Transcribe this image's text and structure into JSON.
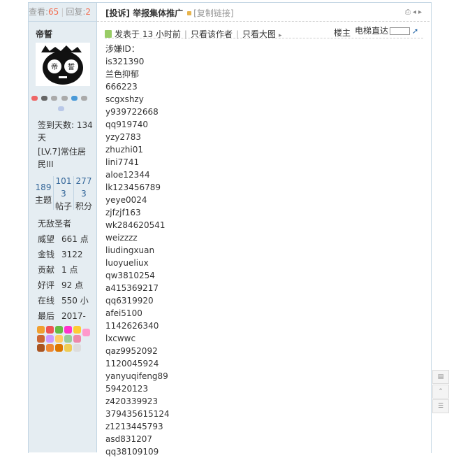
{
  "stats": {
    "views_label": "查看:",
    "views": "65",
    "replies_label": "回复:",
    "replies": "2"
  },
  "thread": {
    "title": "[投诉] 举报集体推广",
    "copy_link": "[复制链接]"
  },
  "author": {
    "username": "帝誓",
    "sign_days": "签到天数: 134 天",
    "level": "[LV.7]常住居民III",
    "counts": [
      {
        "value": "189",
        "label": "主题"
      },
      {
        "value": "1013",
        "label": "帖子"
      },
      {
        "value": "2773",
        "label": "积分"
      }
    ],
    "rank": "无敌圣者",
    "fields": [
      {
        "key": "威望",
        "value": "661 点"
      },
      {
        "key": "金钱",
        "value": "3122"
      },
      {
        "key": "贡献",
        "value": "1 点"
      },
      {
        "key": "好评",
        "value": "92 点"
      },
      {
        "key": "在线",
        "value": "550 小"
      },
      {
        "key": "最后",
        "value": "2017-"
      }
    ]
  },
  "post_meta": {
    "posted": "发表于 13 小时前",
    "only_author": "只看该作者",
    "big_image": "只看大图",
    "floor": "楼主",
    "elevator": "电梯直达"
  },
  "content_lines": [
    "涉嫌ID：",
    "is321390",
    "兰色抑郁",
    "666223",
    "scgxshzy",
    "y939722668",
    "qq919740",
    "yzy2783",
    "zhuzhi01",
    "lini7741",
    "aloe12344",
    "lk123456789",
    "yeye0024",
    "zjfzjf163",
    "wk284620541",
    "weizzzz",
    "liudingxuan",
    "luoyueliux",
    "qw3810254",
    "a415369217",
    "qq6319920",
    "afei5100",
    "1142626340",
    "lxcwwc",
    "qaz9952092",
    "1120045924",
    "yanyuqifeng89",
    "59420123",
    "z420339923",
    "379435615124",
    "z1213445793",
    "asd831207",
    "qq38109109"
  ]
}
